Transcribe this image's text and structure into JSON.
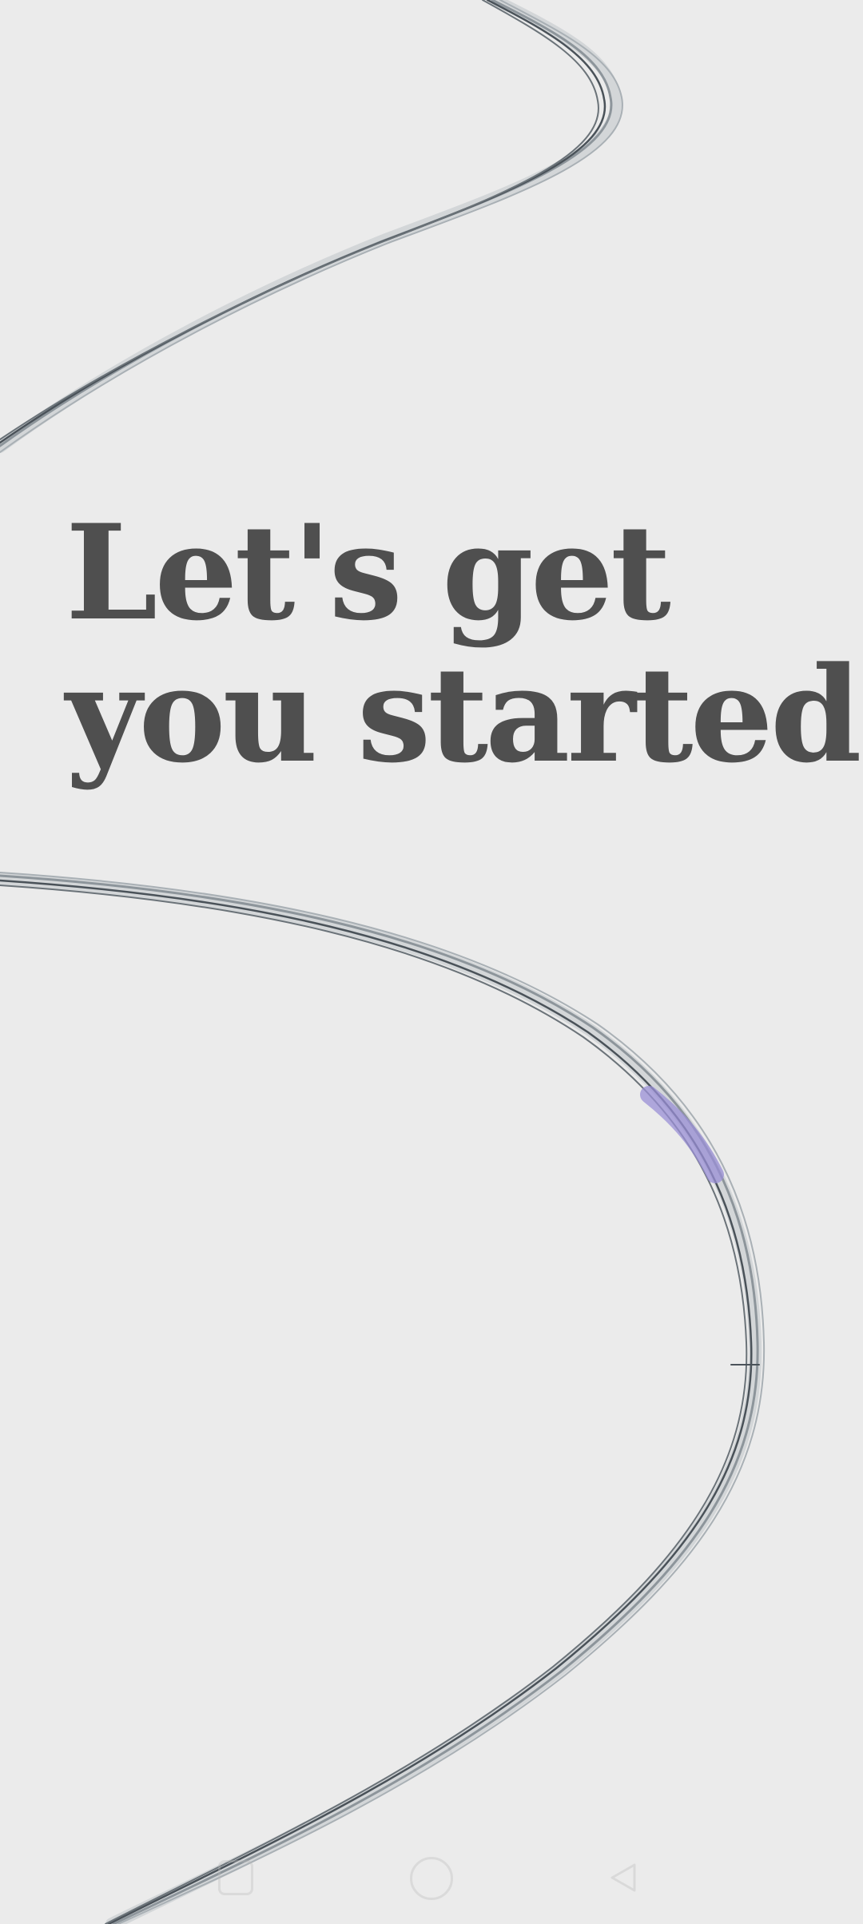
{
  "headline": {
    "line1": "Let's get",
    "line2": "you started"
  },
  "colors": {
    "background": "#ebebeb",
    "headline_text": "#4f4f4f",
    "curve_stroke": "#4a5259",
    "curve_highlight": "#9a8fd6"
  },
  "nav_bar": {
    "recent_icon": "square-recent-apps-icon",
    "home_icon": "circle-home-icon",
    "back_icon": "triangle-back-icon"
  }
}
